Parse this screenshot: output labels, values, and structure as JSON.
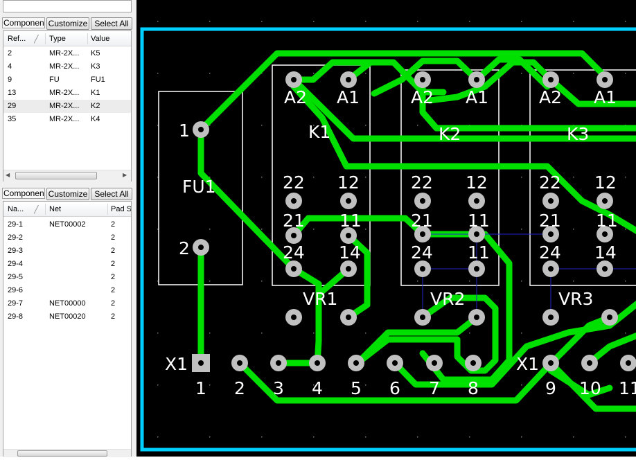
{
  "components_panel": {
    "caption": "Componen",
    "customize_label": "Customize",
    "select_all_label": "Select All",
    "columns": [
      "Ref...",
      "Type",
      "Value"
    ],
    "rows": [
      {
        "ref": "2",
        "type": "MR-2X...",
        "value": "K5"
      },
      {
        "ref": "4",
        "type": "MR-2X...",
        "value": "K3"
      },
      {
        "ref": "9",
        "type": "FU",
        "value": "FU1"
      },
      {
        "ref": "13",
        "type": "MR-2X...",
        "value": "K1"
      },
      {
        "ref": "29",
        "type": "MR-2X...",
        "value": "K2"
      },
      {
        "ref": "35",
        "type": "MR-2X...",
        "value": "K4"
      }
    ]
  },
  "pads_panel": {
    "caption": "Componen",
    "customize_label": "Customize",
    "select_all_label": "Select All",
    "columns": [
      "Na...",
      "Net",
      "Pad S"
    ],
    "rows": [
      {
        "name": "29-1",
        "net": "NET00002",
        "pad": "2"
      },
      {
        "name": "29-2",
        "net": "",
        "pad": "2"
      },
      {
        "name": "29-3",
        "net": "",
        "pad": "2"
      },
      {
        "name": "29-4",
        "net": "",
        "pad": "2"
      },
      {
        "name": "29-5",
        "net": "",
        "pad": "2"
      },
      {
        "name": "29-6",
        "net": "",
        "pad": "2"
      },
      {
        "name": "29-7",
        "net": "NET00000",
        "pad": "2"
      },
      {
        "name": "29-8",
        "net": "NET00020",
        "pad": "2"
      }
    ]
  },
  "board": {
    "colors": {
      "background": "#000000",
      "outline": "#00d0ff",
      "trace": "#00e000",
      "pad": "#c0c0c0",
      "silk": "#ffffff",
      "ratsnest": "#2020c0"
    },
    "labels": {
      "fu1": "FU1",
      "fu_pin1": "1",
      "fu_pin2": "2",
      "k1": "K1",
      "k2": "K2",
      "k3": "K3",
      "relay_pin_a2": "A2",
      "relay_pin_a1": "A1",
      "relay_pin_22": "22",
      "relay_pin_12": "12",
      "relay_pin_21": "21",
      "relay_pin_11": "11",
      "relay_pin_24": "24",
      "relay_pin_14": "14",
      "vr1": "VR1",
      "vr2": "VR2",
      "vr3": "VR3",
      "x1": "X1",
      "x1_right": "X1",
      "header_pins": [
        "1",
        "2",
        "3",
        "4",
        "5",
        "6",
        "7",
        "8",
        "9",
        "10",
        "11"
      ]
    }
  }
}
